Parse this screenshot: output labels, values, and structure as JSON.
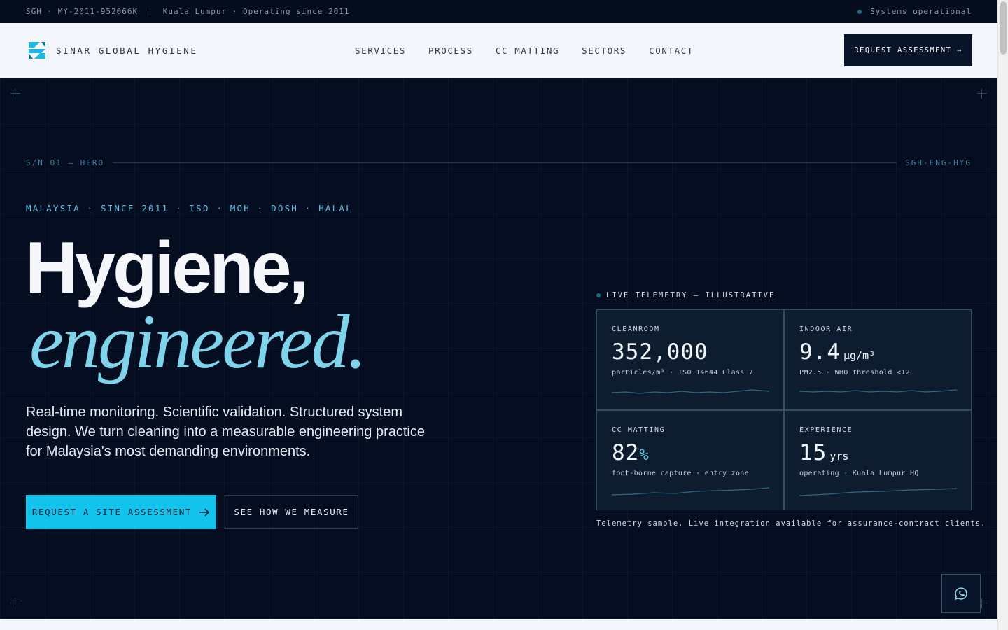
{
  "topbar": {
    "code": "SGH · MY-2011-952066K",
    "separator": "|",
    "location": "Kuala Lumpur · Operating since 2011",
    "status": "Systems operational"
  },
  "nav": {
    "brand": "SINAR GLOBAL HYGIENE",
    "items": [
      {
        "label": "SERVICES"
      },
      {
        "label": "PROCESS"
      },
      {
        "label": "CC MATTING"
      },
      {
        "label": "SECTORS"
      },
      {
        "label": "CONTACT"
      }
    ],
    "cta": "REQUEST ASSESSMENT →"
  },
  "hero": {
    "serial_left": "S/N 01 — HERO",
    "serial_right": "SGH-ENG-HYG",
    "tags": "MALAYSIA · SINCE 2011 · ISO · MOH · DOSH · HALAL",
    "headline_1": "Hygiene,",
    "headline_2": "engineered.",
    "lead": "Real-time monitoring. Scientific validation. Structured system design. We turn cleaning into a measurable engineering practice for Malaysia's most demanding environments.",
    "cta_primary": "REQUEST A SITE ASSESSMENT",
    "cta_secondary": "SEE HOW WE MEASURE"
  },
  "telemetry": {
    "label": "LIVE TELEMETRY — ILLUSTRATIVE",
    "cells": [
      {
        "label": "CLEANROOM",
        "value": "352,000",
        "unit": "",
        "sub": "particles/m³ · ISO 14644 Class 7"
      },
      {
        "label": "INDOOR AIR",
        "value": "9.4",
        "unit": "µg/m³",
        "sub": "PM2.5 · WHO threshold <12"
      },
      {
        "label": "CC MATTING",
        "value": "82",
        "unit": "%",
        "sub": "foot-borne capture · entry zone"
      },
      {
        "label": "EXPERIENCE",
        "value": "15",
        "unit": "yrs",
        "sub": "operating · Kuala Lumpur HQ"
      }
    ],
    "note": "Telemetry sample. Live integration available for assurance-contract clients."
  },
  "colors": {
    "accent": "#12c4ec",
    "accent_soft": "#7fd4ec",
    "navy": "#06101f",
    "nav_bg": "#f3f6fa"
  },
  "icons": {
    "brand": "sgh-logo-icon",
    "status": "status-dot-icon",
    "arrow": "arrow-right-icon",
    "chat": "whatsapp-icon"
  }
}
